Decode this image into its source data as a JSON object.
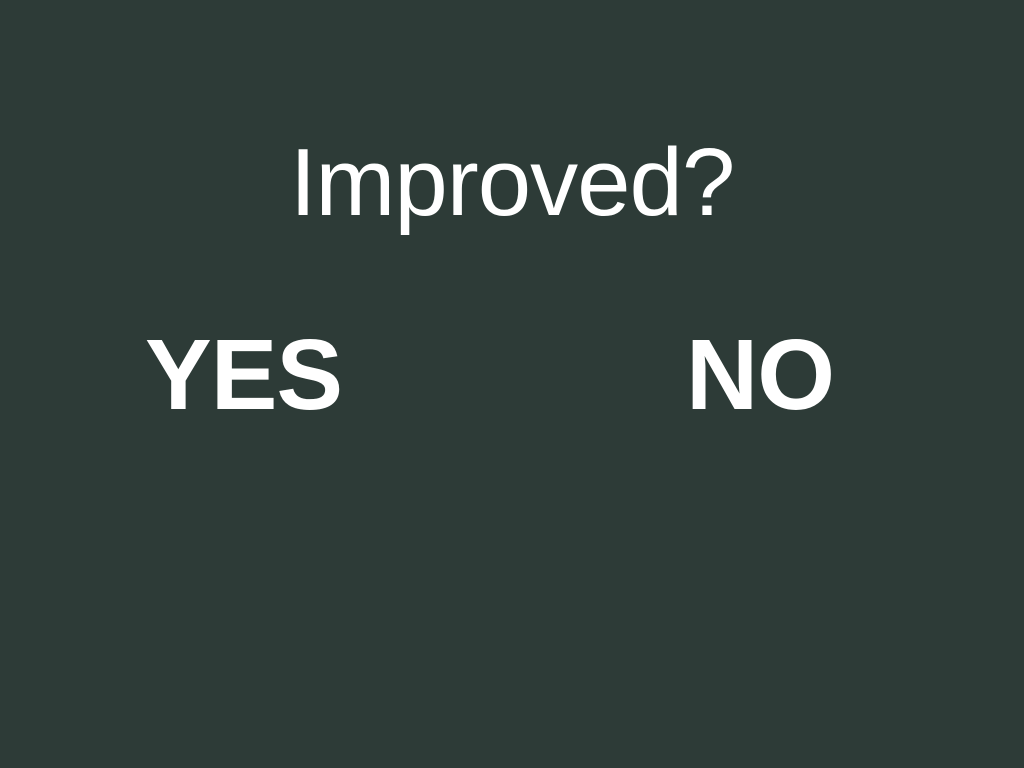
{
  "prompt": {
    "question": "Improved?"
  },
  "choices": {
    "yes_label": "YES",
    "no_label": "NO"
  },
  "colors": {
    "background": "#2d3b37",
    "text": "#ffffff"
  }
}
